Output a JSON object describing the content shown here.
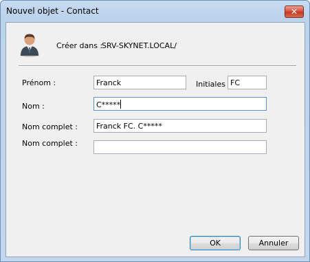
{
  "window": {
    "title": "Nouvel objet - Contact",
    "close_glyph": "✕"
  },
  "header": {
    "create_label": "Créer dans :",
    "create_path": "SRV-SKYNET.LOCAL/",
    "icon": "contact-person-icon"
  },
  "form": {
    "prenom_label": "Prénom :",
    "prenom_value": "Franck",
    "initiales_label": "Initiales :",
    "initiales_value": "FC",
    "nom_label": "Nom :",
    "nom_value": "C*****",
    "nom_complet_label": "Nom complet :",
    "nom_complet_value": "Franck FC. C*****",
    "nom_complet2_label": "Nom complet :",
    "nom_complet2_value": ""
  },
  "buttons": {
    "ok": "OK",
    "cancel": "Annuler"
  }
}
